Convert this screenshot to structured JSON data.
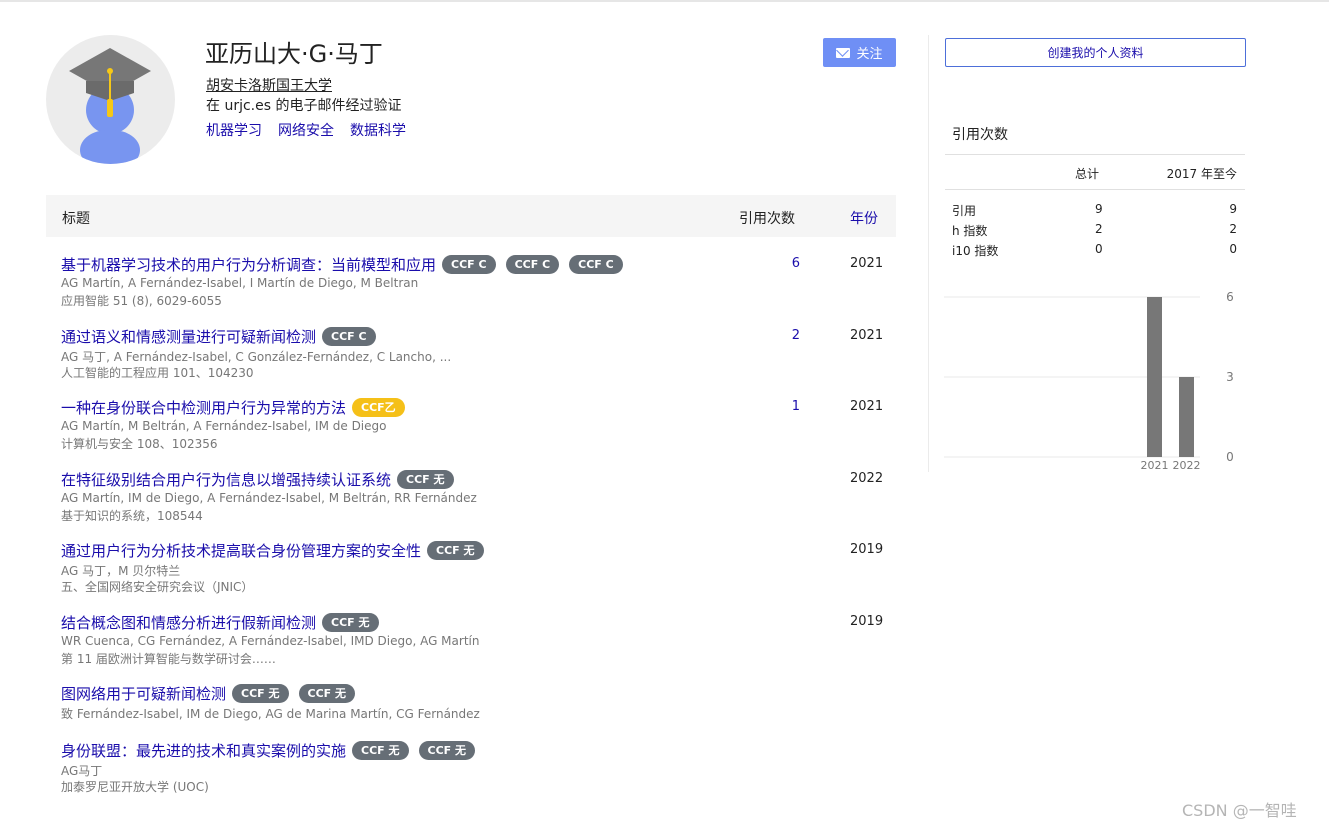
{
  "profile": {
    "name": "亚历山大·G·马丁",
    "affiliation": "胡安卡洛斯国王大学",
    "verified": "在 urjc.es 的电子邮件经过验证",
    "interests": [
      "机器学习",
      "网络安全",
      "数据科学"
    ],
    "follow_label": "关注"
  },
  "table": {
    "header": {
      "title": "标题",
      "cited_by": "引用次数",
      "year": "年份"
    },
    "rows": [
      {
        "title": "基于机器学习技术的用户行为分析调查：当前模型和应用",
        "badges": [
          "CCF C",
          "CCF C",
          "CCF C"
        ],
        "authors": "AG Martín, A Fernández-Isabel, I Martín de Diego, M Beltran",
        "venue": "应用智能 51 (8), 6029-6055",
        "cites": "6",
        "year": "2021"
      },
      {
        "title": "通过语义和情感测量进行可疑新闻检测",
        "badges": [
          "CCF C"
        ],
        "authors": "AG 马丁, A Fernández-Isabel, C González-Fernández, C Lancho, ...",
        "venue": "人工智能的工程应用 101、104230",
        "cites": "2",
        "year": "2021"
      },
      {
        "title": "一种在身份联合中检测用户行为异常的方法",
        "badges": [
          "CCF乙"
        ],
        "authors": "AG Martín, M Beltrán, A Fernández-Isabel, IM de Diego",
        "venue": "计算机与安全 108、102356",
        "cites": "1",
        "year": "2021"
      },
      {
        "title": "在特征级别结合用户行为信息以增强持续认证系统",
        "badges": [
          "CCF 无"
        ],
        "authors": "AG Martín, IM de Diego, A Fernández-Isabel, M Beltrán, RR Fernández",
        "venue": "基于知识的系统，108544",
        "cites": "",
        "year": "2022"
      },
      {
        "title": "通过用户行为分析技术提高联合身份管理方案的安全性",
        "badges": [
          "CCF 无"
        ],
        "authors": "AG 马丁，M 贝尔特兰",
        "venue": "五、全国网络安全研究会议（JNIC）",
        "cites": "",
        "year": "2019"
      },
      {
        "title": "结合概念图和情感分析进行假新闻检测",
        "badges": [
          "CCF 无"
        ],
        "authors": "WR Cuenca, CG Fernández, A Fernández-Isabel, IMD Diego, AG Martín",
        "venue": "第 11 届欧洲计算智能与数学研讨会……",
        "cites": "",
        "year": "2019"
      },
      {
        "title": "图网络用于可疑新闻检测",
        "badges": [
          "CCF 无",
          "CCF 无"
        ],
        "authors": "致 Fernández-Isabel, IM de Diego, AG de Marina Martín, CG Fernández",
        "venue": "",
        "cites": "",
        "year": ""
      },
      {
        "title": "身份联盟：最先进的技术和真实案例的实施",
        "badges": [
          "CCF 无",
          "CCF 无"
        ],
        "authors": "AG马丁",
        "venue": "加泰罗尼亚开放大学 (UOC)",
        "cites": "",
        "year": ""
      }
    ]
  },
  "sidebar": {
    "create_profile": "创建我的个人资料",
    "cited_by_heading": "引用次数",
    "stats_header": {
      "all": "总计",
      "since": "2017 年至今"
    },
    "stats": [
      {
        "label": "引用",
        "all": "9",
        "since": "9"
      },
      {
        "label": "h 指数",
        "all": "2",
        "since": "2"
      },
      {
        "label": "i10 指数",
        "all": "0",
        "since": "0"
      }
    ]
  },
  "chart_data": {
    "type": "bar",
    "categories": [
      "2021",
      "2022"
    ],
    "values": [
      6,
      3
    ],
    "title": "",
    "xlabel": "",
    "ylabel": "",
    "ylim": [
      0,
      6
    ],
    "yticks": [
      "6",
      "3",
      "0"
    ],
    "bar_color": "#777777",
    "grid": true
  },
  "watermark": "CSDN @一智哇",
  "colors": {
    "link": "#1a0dab",
    "ccf_c": "#1fa34a",
    "ccf_b": "#f5c018",
    "ccf_none": "#666e76"
  }
}
